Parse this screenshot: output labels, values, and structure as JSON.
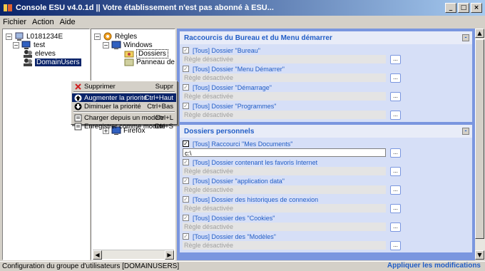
{
  "window": {
    "title": "Console ESU v4.0.1d || Votre établissement n'est pas abonné à ESU...",
    "controls": [
      "_",
      "□",
      "×"
    ]
  },
  "menu": [
    "Fichier",
    "Action",
    "Aide"
  ],
  "tree_left": {
    "root": "L0181234E",
    "child": "test",
    "items": [
      "eleves",
      "DomainUsers"
    ]
  },
  "tree_mid": {
    "root": "Règles",
    "child": "Windows",
    "items": [
      "Dossiers",
      "Panneau de co..."
    ],
    "extra": "Firefox"
  },
  "context_menu": {
    "items": [
      {
        "label": "Supprimer",
        "shortcut": "Suppr",
        "icon": "delete-x-icon"
      },
      {
        "label": "Augmenter la priorité",
        "shortcut": "Ctrl+Haut",
        "icon": "arrow-up-icon"
      },
      {
        "label": "Diminuer la priorité",
        "shortcut": "Ctrl+Bas",
        "icon": "arrow-down-icon"
      },
      {
        "label": "Charger depuis un modèle",
        "shortcut": "Ctrl+L",
        "icon": "load-template-icon"
      },
      {
        "label": "Enregistrer comme modèle",
        "shortcut": "Ctrl+S",
        "icon": "save-template-icon"
      }
    ]
  },
  "sections": [
    {
      "title": "Raccourcis du Bureau et du Menu démarrer",
      "items": [
        {
          "label": "[Tous] Dossier \"Bureau\"",
          "value": "Règle désactivée",
          "checked": false
        },
        {
          "label": "[Tous] Dossier \"Menu Démarrer\"",
          "value": "Règle désactivée",
          "checked": false
        },
        {
          "label": "[Tous] Dossier \"Démarrage\"",
          "value": "Règle désactivée",
          "checked": false
        },
        {
          "label": "[Tous] Dossier \"Programmes\"",
          "value": "Règle désactivée",
          "checked": false
        }
      ]
    },
    {
      "title": "Dossiers personnels",
      "items": [
        {
          "label": "[Tous] Raccourci \"Mes Documents\"",
          "value": "c:\\",
          "checked": true
        },
        {
          "label": "[Tous] Dossier contenant les favoris Internet",
          "value": "Règle désactivée",
          "checked": false
        },
        {
          "label": "[Tous] Dossier \"application data\"",
          "value": "Règle désactivée",
          "checked": false
        },
        {
          "label": "[Tous] Dossier des historiques de connexion",
          "value": "Règle désactivée",
          "checked": false
        },
        {
          "label": "[Tous] Dossier des \"Cookies\"",
          "value": "Règle désactivée",
          "checked": false
        },
        {
          "label": "[Tous] Dossier des \"Modèles\"",
          "value": "Règle désactivée",
          "checked": false
        }
      ]
    }
  ],
  "browse_label": "...",
  "status": {
    "text": "Configuration du groupe d'utilisateurs [DOMAINUSERS]",
    "apply": "Appliquer les modifications"
  },
  "colors": {
    "accent": "#215dc6",
    "panel_bg": "#7a96df",
    "selection": "#0a246a"
  }
}
